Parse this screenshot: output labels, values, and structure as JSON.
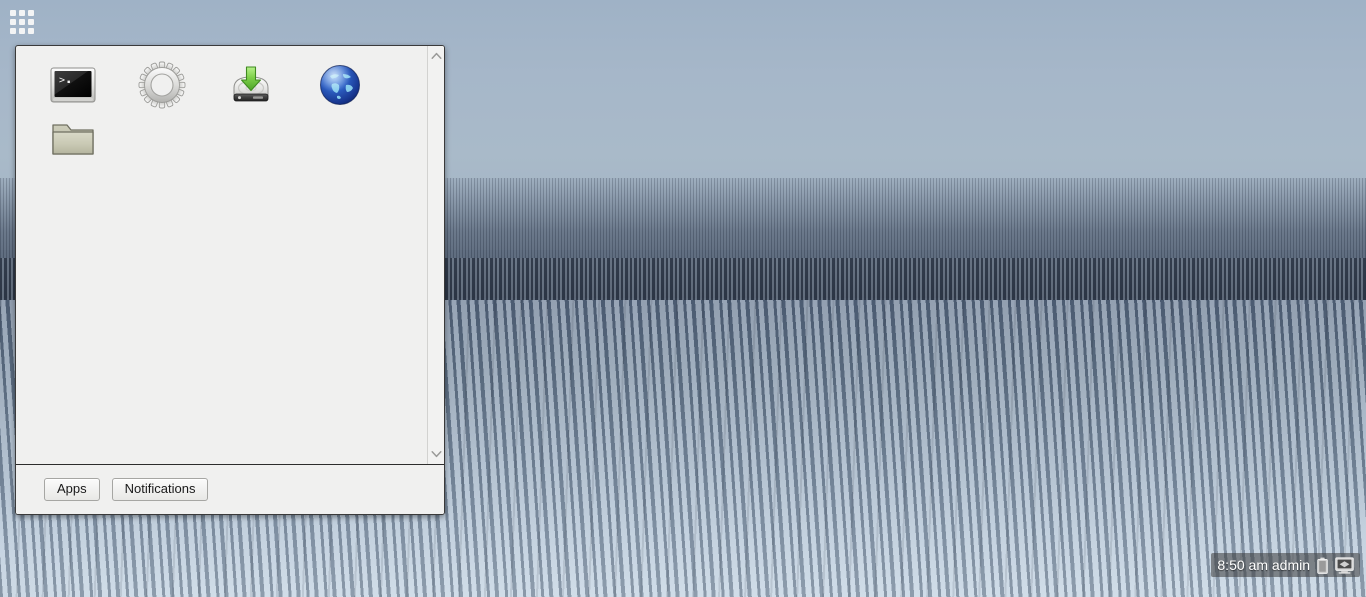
{
  "desktop": {
    "wallpaper_name": "winter-snowy-spruce-forest",
    "colors": {
      "sky": "#a6b7c9",
      "far_forest": "#56637 6",
      "panel_bg": "#f0f0ef",
      "panel_border": "#3a3a3a",
      "tray_bg": "rgba(58,58,58,0.55)",
      "tray_text": "#ffffff"
    }
  },
  "app_grid": {
    "name": "app-grid-launcher",
    "cells": [
      "",
      "",
      "",
      "",
      "",
      "",
      "",
      "",
      ""
    ]
  },
  "panel": {
    "icons": [
      {
        "name": "terminal-icon",
        "label": "Terminal"
      },
      {
        "name": "gear-icon",
        "label": "Settings"
      },
      {
        "name": "harddisk-download-icon",
        "label": "Install"
      },
      {
        "name": "globe-icon",
        "label": "Web Browser"
      },
      {
        "name": "folder-icon",
        "label": "File Manager"
      }
    ],
    "scrollbar": {
      "up_arrow": "scroll-up-icon",
      "down_arrow": "scroll-down-icon"
    },
    "footer": {
      "buttons": [
        {
          "name": "apps-button",
          "label": "Apps"
        },
        {
          "name": "notifications-button",
          "label": "Notifications"
        }
      ]
    }
  },
  "systray": {
    "clock": "8:50 am admin",
    "icons": [
      {
        "name": "battery-icon",
        "label": "Battery"
      },
      {
        "name": "display-icon",
        "label": "Display"
      }
    ]
  }
}
